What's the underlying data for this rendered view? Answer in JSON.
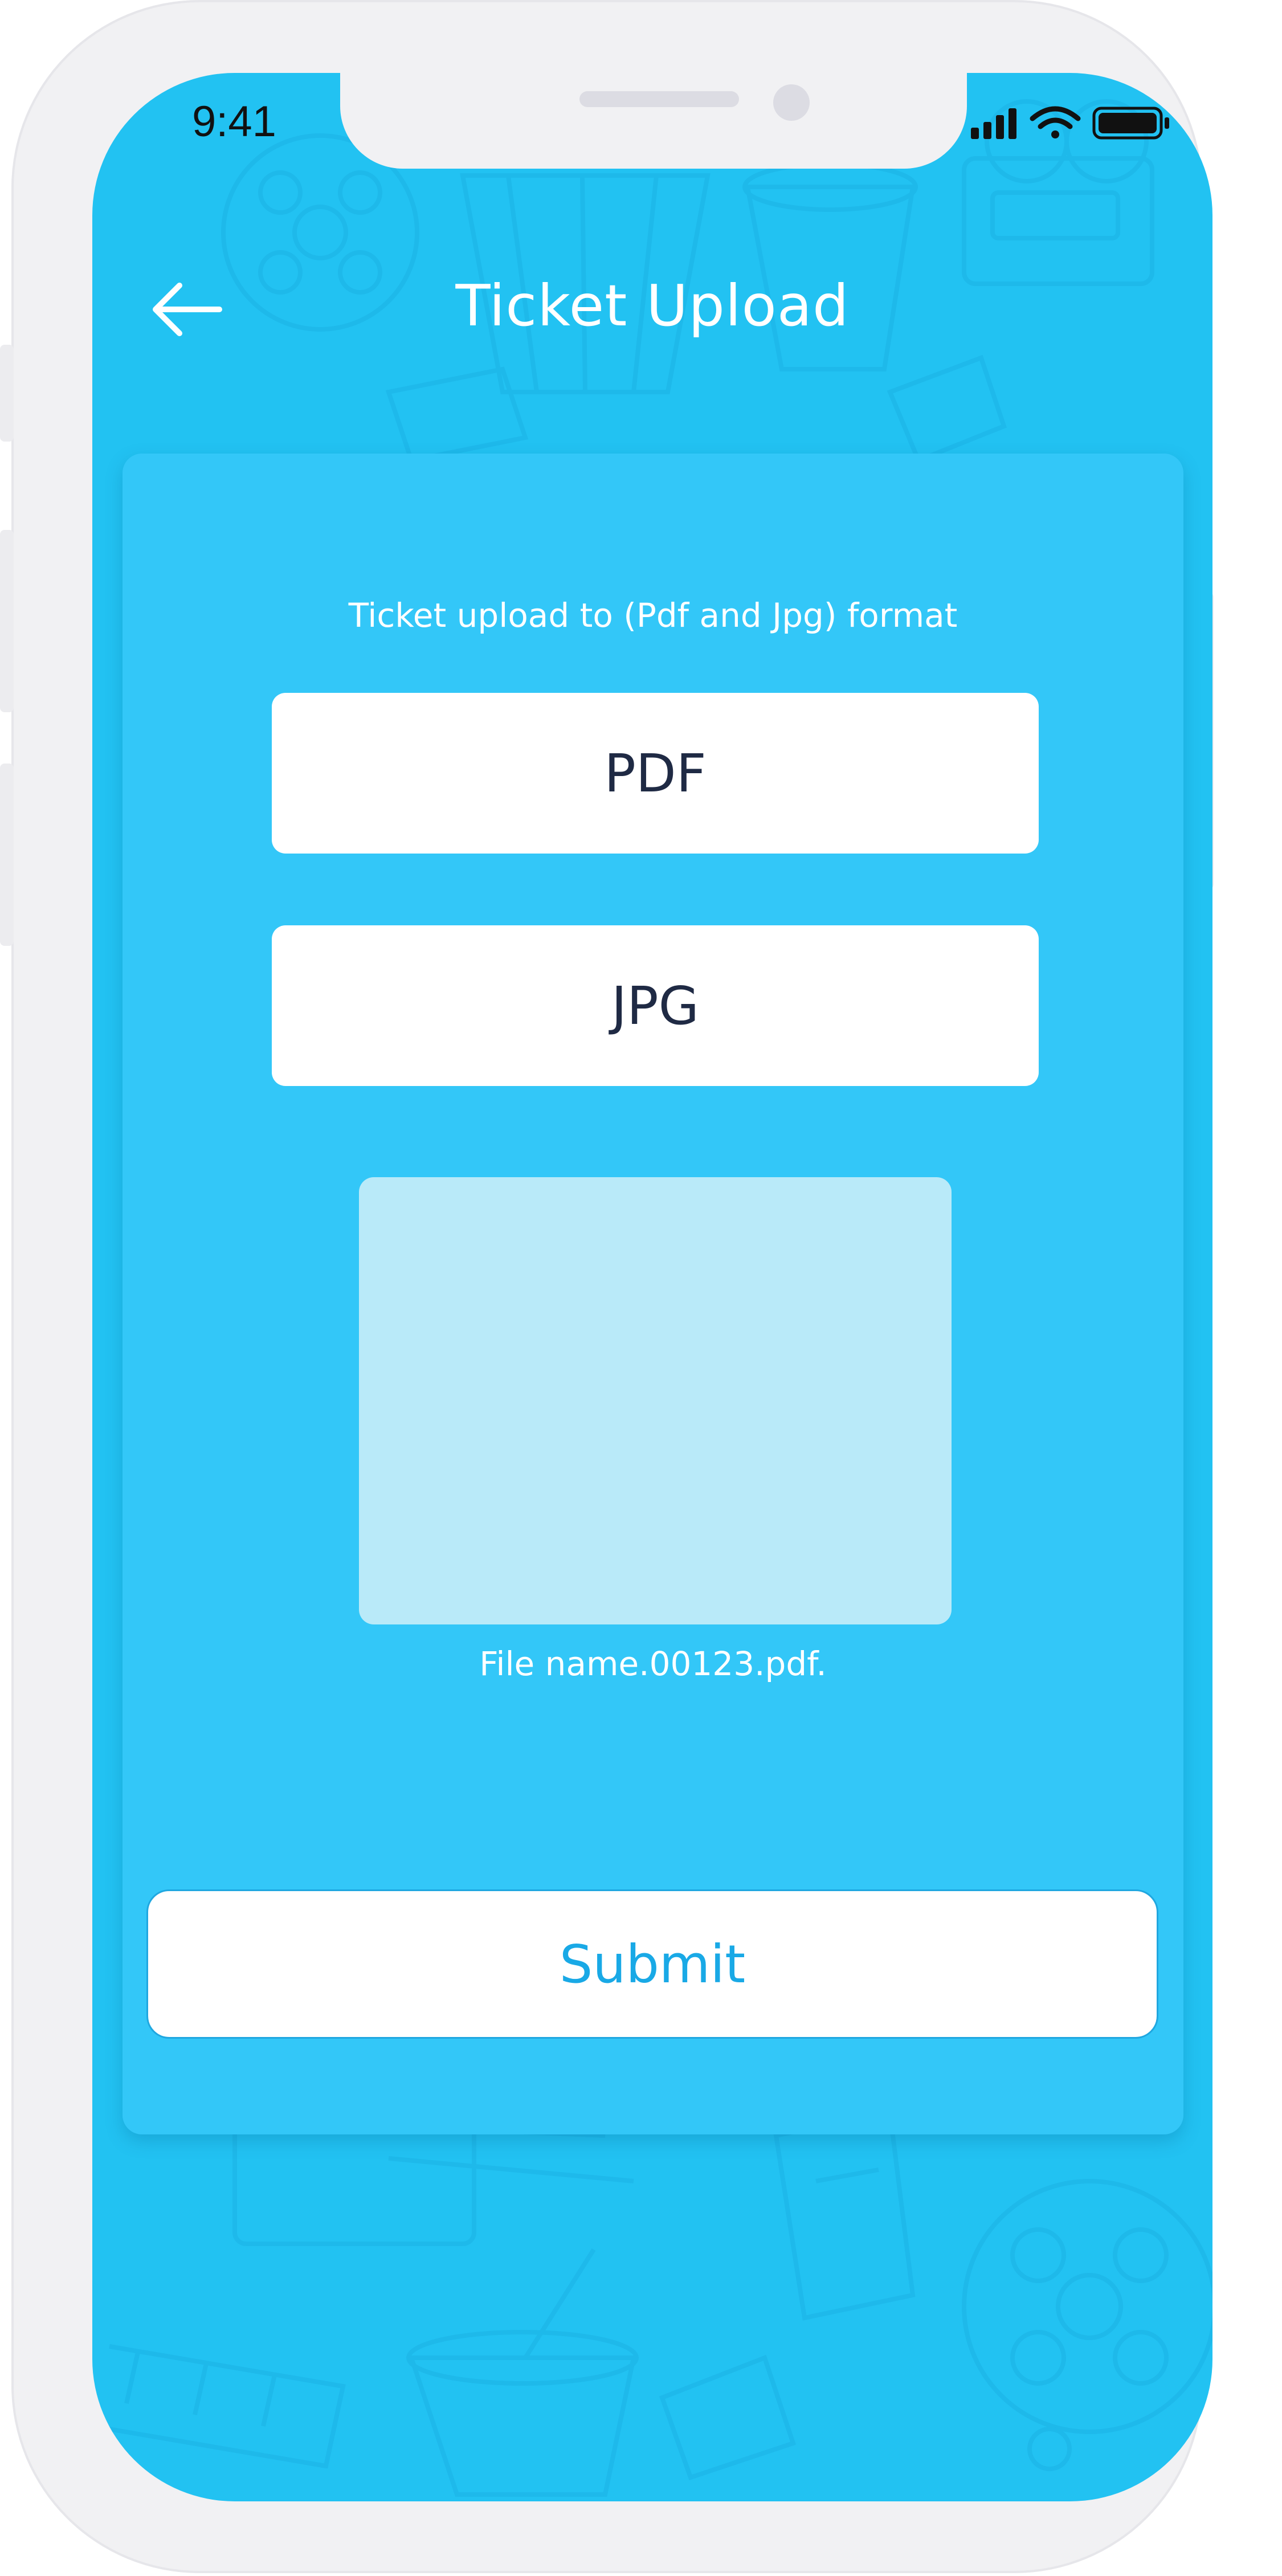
{
  "status_bar": {
    "time": "9:41"
  },
  "header": {
    "title": "Ticket Upload",
    "back_icon": "arrow-left-icon"
  },
  "card": {
    "instruction": "Ticket upload to (Pdf and Jpg) format",
    "options": [
      {
        "label": "PDF"
      },
      {
        "label": "JPG"
      }
    ],
    "file_name": "File name.00123.pdf.",
    "submit_label": "Submit"
  },
  "colors": {
    "screen_bg": "#22c2f2",
    "card_bg": "#33c7f8",
    "preview_bg": "#b9eaf9",
    "button_text": "#1f2a44",
    "submit_text": "#19a9e6"
  }
}
